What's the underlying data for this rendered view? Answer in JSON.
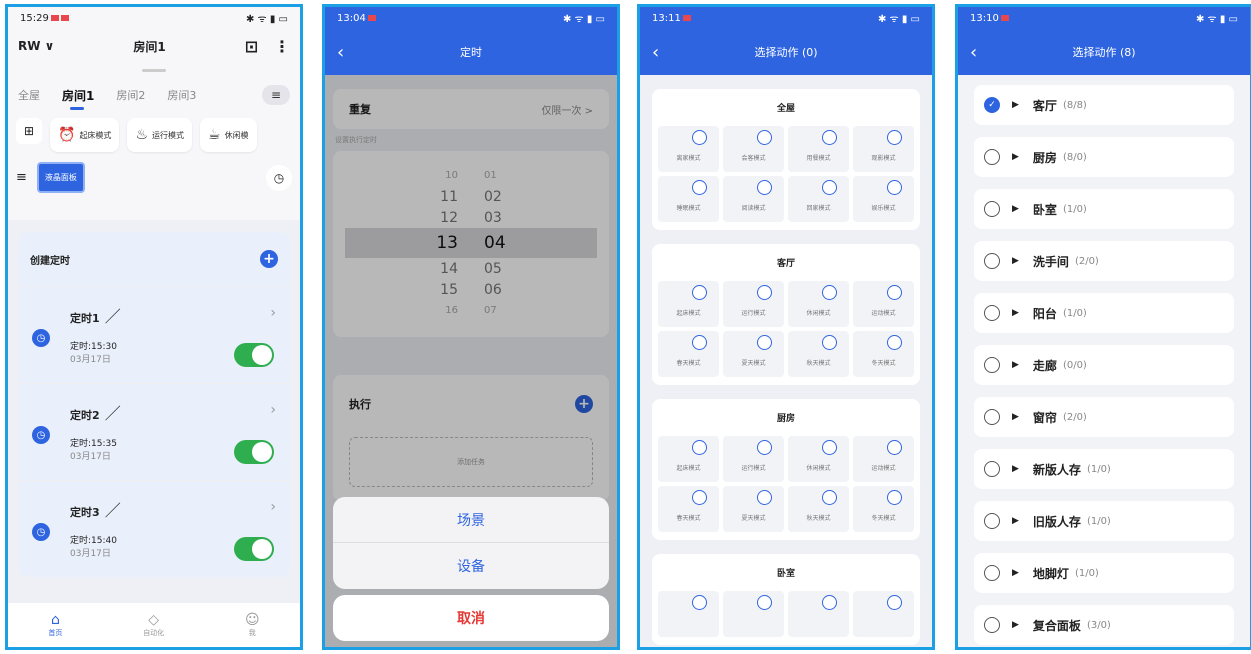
{
  "s1": {
    "time": "15:29",
    "status": "✱ ᯤ ▮ ▭",
    "account": "RW ∨",
    "title": "房间1",
    "tabs": [
      "全屋",
      "房间1",
      "房间2",
      "房间3"
    ],
    "modes": [
      {
        "icon": "⏰",
        "label": "起床模式"
      },
      {
        "icon": "♨",
        "label": "运行模式"
      },
      {
        "icon": "☕",
        "label": "休闲模"
      }
    ],
    "lcd": "液晶面板",
    "create": "创建定时",
    "timers": [
      {
        "name": "定时1",
        "time": "定时:15:30",
        "date": "03月17日"
      },
      {
        "name": "定时2",
        "time": "定时:15:35",
        "date": "03月17日"
      },
      {
        "name": "定时3",
        "time": "定时:15:40",
        "date": "03月17日"
      }
    ],
    "nav": [
      {
        "icon": "⌂",
        "label": "首页"
      },
      {
        "icon": "◇",
        "label": "自动化"
      },
      {
        "icon": "☺",
        "label": "我"
      }
    ]
  },
  "s2": {
    "time": "13:04",
    "title": "定时",
    "repeat": "重复",
    "repeat_val": "仅限一次 >",
    "sub": "设置执行定时",
    "rows": [
      [
        "10",
        "01"
      ],
      [
        "11",
        "02"
      ],
      [
        "12",
        "03"
      ],
      [
        "13",
        "04"
      ],
      [
        "14",
        "05"
      ],
      [
        "15",
        "06"
      ],
      [
        "16",
        "07"
      ]
    ],
    "exec": "执行",
    "add": "添加任务",
    "opts": [
      "场景",
      "设备"
    ],
    "cancel": "取消"
  },
  "s3": {
    "time": "13:11",
    "title": "选择动作 (0)",
    "groups": [
      {
        "name": "全屋",
        "items": [
          "离家模式",
          "会客模式",
          "用餐模式",
          "观影模式",
          "睡眠模式",
          "阅读模式",
          "回家模式",
          "娱乐模式"
        ]
      },
      {
        "name": "客厅",
        "items": [
          "起床模式",
          "运行模式",
          "休闲模式",
          "运动模式",
          "春天模式",
          "夏天模式",
          "秋天模式",
          "冬天模式"
        ]
      },
      {
        "name": "厨房",
        "items": [
          "起床模式",
          "运行模式",
          "休闲模式",
          "运动模式",
          "春天模式",
          "夏天模式",
          "秋天模式",
          "冬天模式"
        ]
      },
      {
        "name": "卧室",
        "items": [
          "",
          "",
          "",
          ""
        ]
      }
    ]
  },
  "s4": {
    "time": "13:10",
    "title": "选择动作 (8)",
    "items": [
      {
        "name": "客厅",
        "count": "(8/8)",
        "on": true
      },
      {
        "name": "厨房",
        "count": "(8/0)"
      },
      {
        "name": "卧室",
        "count": "(1/0)"
      },
      {
        "name": "洗手间",
        "count": "(2/0)"
      },
      {
        "name": "阳台",
        "count": "(1/0)"
      },
      {
        "name": "走廊",
        "count": "(0/0)"
      },
      {
        "name": "窗帘",
        "count": "(2/0)"
      },
      {
        "name": "新版人存",
        "count": "(1/0)"
      },
      {
        "name": "旧版人存",
        "count": "(1/0)"
      },
      {
        "name": "地脚灯",
        "count": "(1/0)"
      },
      {
        "name": "复合面板",
        "count": "(3/0)"
      }
    ]
  }
}
